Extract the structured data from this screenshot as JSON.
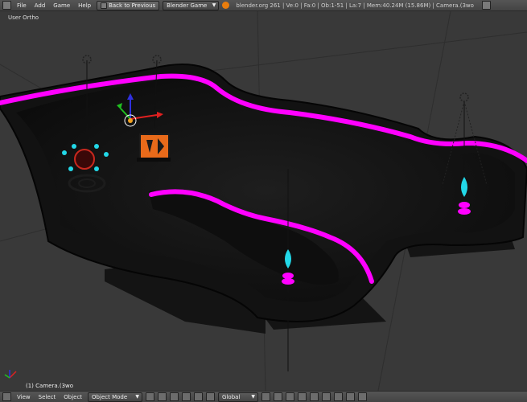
{
  "menu": {
    "items": [
      "File",
      "Add",
      "Game",
      "Help"
    ],
    "back_button": "Back to Previous",
    "engine": "Blender Game",
    "info": "blender.org 261 | Ve:0 | Fa:0 | Ob:1-51 | La:7 | Mem:40.24M (15.86M) | Camera.(3wo"
  },
  "viewport": {
    "view_label": "User Ortho",
    "object_label": "(1) Camera.(3wo"
  },
  "bottom": {
    "items": [
      "View",
      "Select",
      "Object"
    ],
    "mode": "Object Mode",
    "orientation": "Global"
  },
  "colors": {
    "neon": "#ff00ff",
    "cyan": "#22d8e8",
    "orange": "#e86a1a",
    "background": "#393939"
  }
}
